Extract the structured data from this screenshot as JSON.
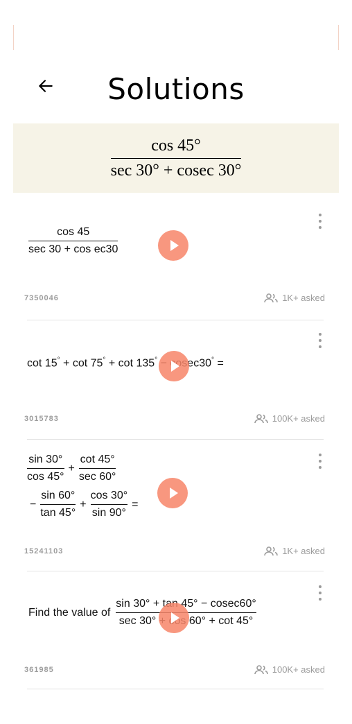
{
  "header": {
    "title": "Solutions",
    "back_icon": "arrow-left-icon"
  },
  "question": {
    "numerator": "cos 45°",
    "denominator": "sec 30° + cosec 30°"
  },
  "cards": [
    {
      "num": "cos 45",
      "den": "sec 30 + cos ec30",
      "id": "7350046",
      "asked": "1K+ asked"
    },
    {
      "expr_a": "cot 15",
      "expr_b": "+ cot 75",
      "expr_c": "+ cot 135",
      "expr_d": "− cosec30",
      "expr_e": "=",
      "deg": "°",
      "id": "3015783",
      "asked": "100K+ asked"
    },
    {
      "f1_num": "sin 30°",
      "f1_den": "cos 45°",
      "f2_num": "cot 45°",
      "f2_den": "sec 60°",
      "f3_num": "sin 60°",
      "f3_den": "tan 45°",
      "f4_num": "cos 30°",
      "f4_den": "sin 90°",
      "plus": "+",
      "minus": "−",
      "equals": "=",
      "id": "15241103",
      "asked": "1K+ asked"
    },
    {
      "prefix": "Find the value of",
      "num": "sin 30° + tan 45° − cosec60°",
      "den": "sec 30° + cos 60° + cot 45°",
      "id": "361985",
      "asked": "100K+ asked"
    }
  ],
  "colors": {
    "banner_bg": "#f6f3e7",
    "play_button": "#f78568",
    "meta_text": "#9c9c9c"
  }
}
